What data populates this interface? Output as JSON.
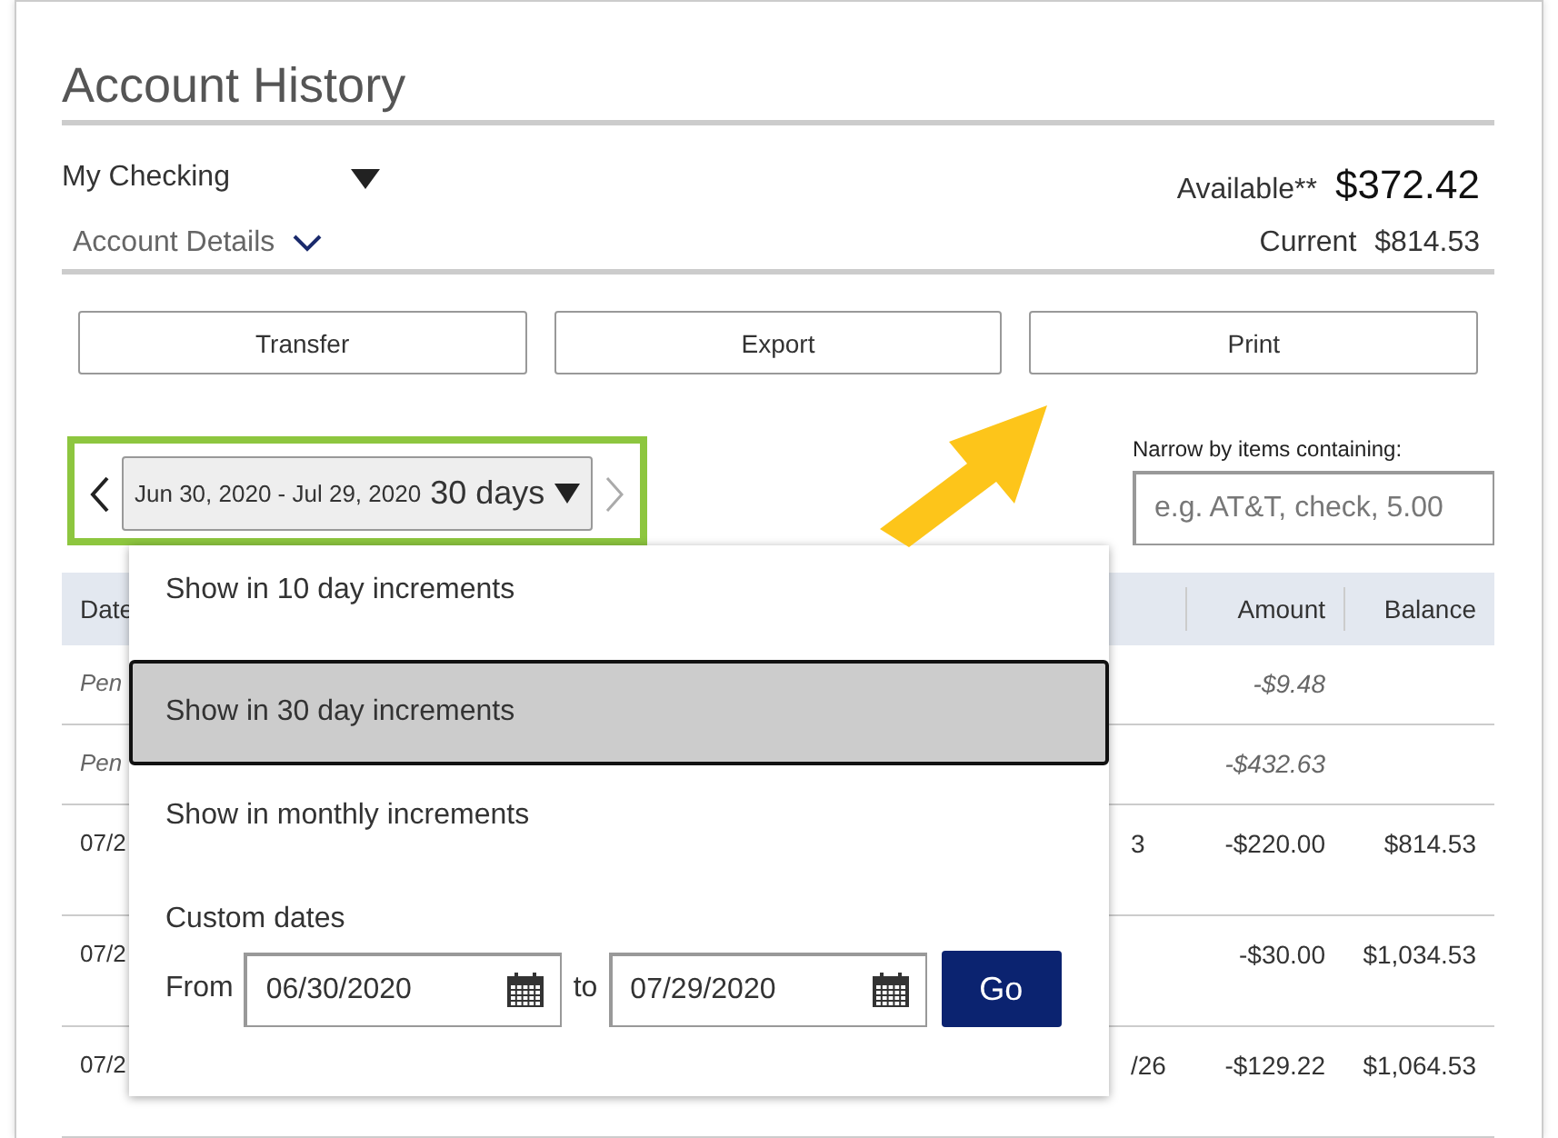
{
  "title": "Account History",
  "account": {
    "name": "My Checking",
    "available_label": "Available**",
    "available": "$372.42",
    "details_link": "Account Details",
    "current_label": "Current",
    "current": "$814.53"
  },
  "buttons": [
    "Transfer",
    "Export",
    "Print"
  ],
  "date_picker": {
    "range": "Jun 30, 2020 - Jul 29, 2020",
    "period": "30 days",
    "next_disabled": true
  },
  "filter": {
    "label": "Narrow by items containing:",
    "placeholder": "e.g. AT&T, check, 5.00"
  },
  "table": {
    "header": {
      "date": "Date",
      "amount": "Amount",
      "balance": "Balance"
    },
    "rows": [
      {
        "date": "Pen",
        "amount": "-$9.48",
        "pending": true
      },
      {
        "date": "Pen",
        "amount": "-$432.63",
        "pending": true
      },
      {
        "date": "07/2",
        "description": "3",
        "amount": "-$220.00",
        "balance": "$814.53",
        "pending": false
      },
      {
        "date": "07/2",
        "amount": "-$30.00",
        "balance": "$1,034.53",
        "pending": false
      },
      {
        "date": "07/2",
        "description": "/26",
        "amount": "-$129.22",
        "balance": "$1,064.53",
        "pending": false
      }
    ]
  },
  "dropdown": {
    "options": [
      {
        "label": "Show in 10 day increments",
        "selected": false
      },
      {
        "label": "Show in 30 day increments",
        "selected": true
      },
      {
        "label": "Show in monthly increments",
        "selected": false
      }
    ],
    "custom": {
      "label": "Custom dates",
      "from_label": "From",
      "from": "06/30/2020",
      "to_label": "to",
      "to": "07/29/2020",
      "button": "Go"
    }
  }
}
